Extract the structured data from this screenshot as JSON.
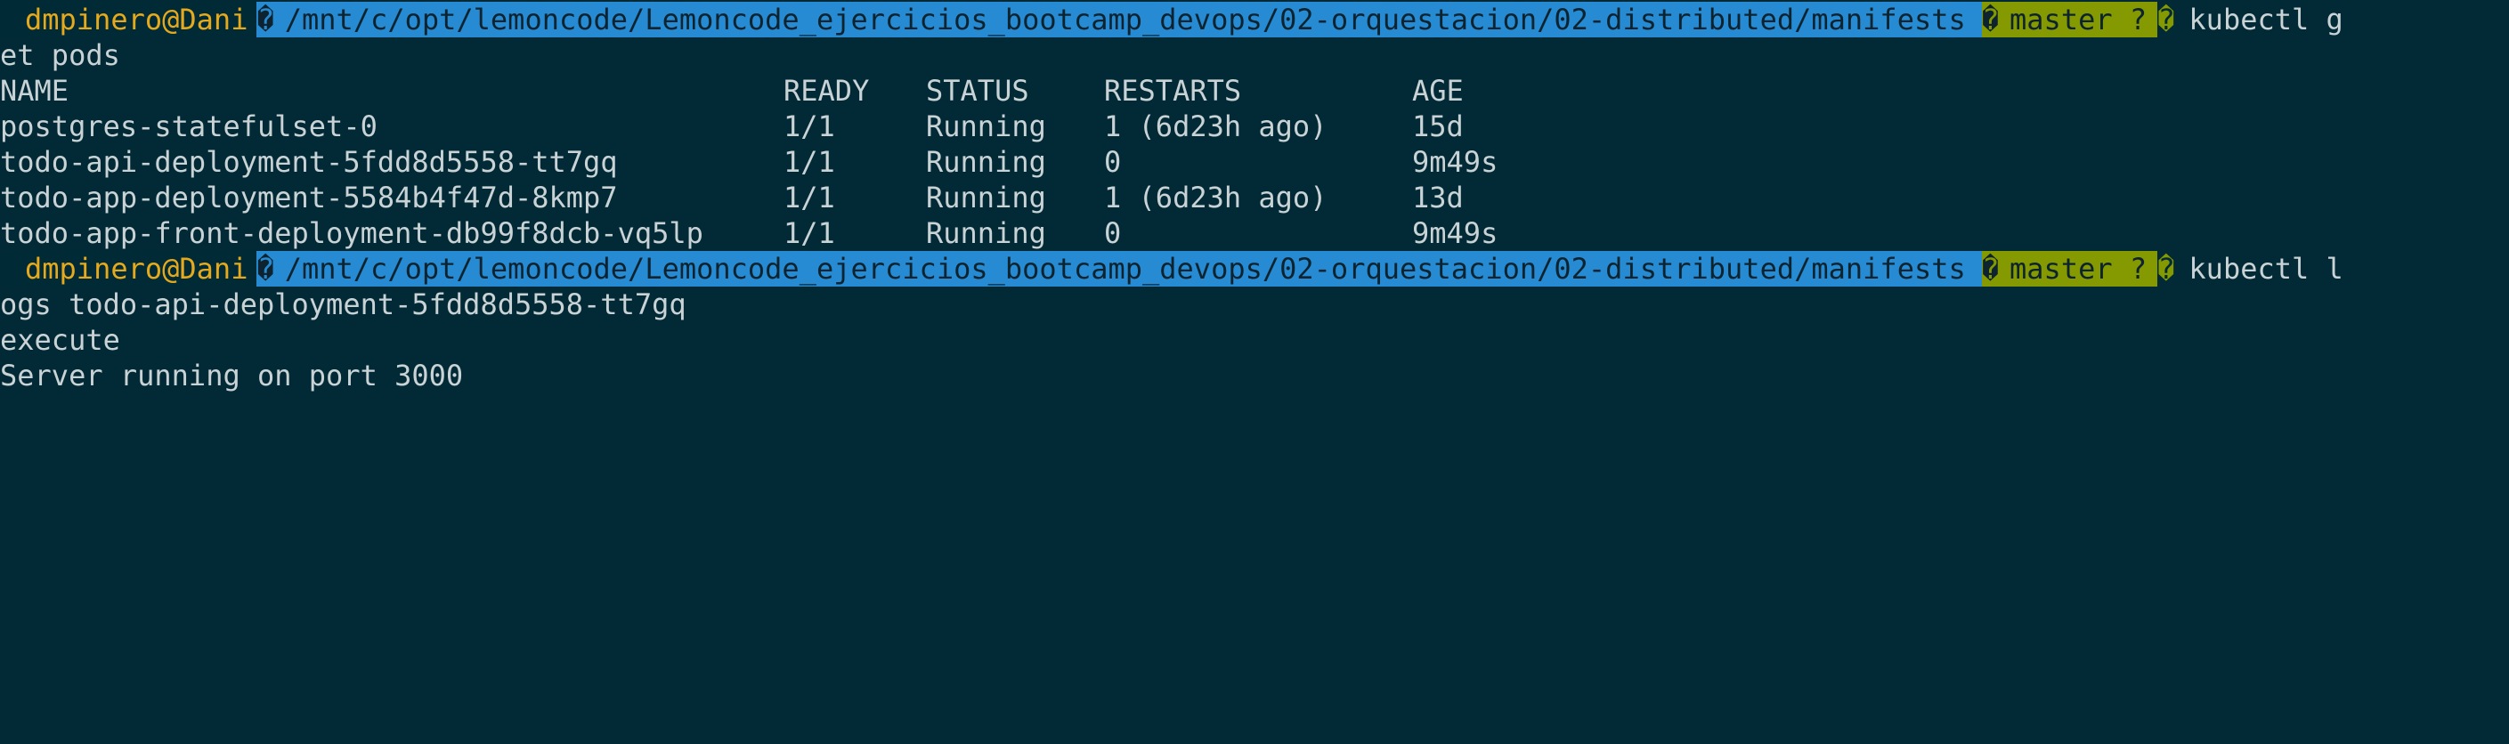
{
  "prompts": [
    {
      "user": "dmpinero@Dani",
      "path": "/mnt/c/opt/lemoncode/Lemoncode_ejercicios_bootcamp_devops/02-orquestacion/02-distributed/manifests",
      "branch": "master ?",
      "command_line1": "kubectl g",
      "command_line2": "et pods"
    },
    {
      "user": "dmpinero@Dani",
      "path": "/mnt/c/opt/lemoncode/Lemoncode_ejercicios_bootcamp_devops/02-orquestacion/02-distributed/manifests",
      "branch": "master ?",
      "command_line1": "kubectl l",
      "command_line2": "ogs todo-api-deployment-5fdd8d5558-tt7gq"
    }
  ],
  "glyphs": {
    "path_separator": "�",
    "git_separator": "�",
    "end_separator": "�"
  },
  "pods_table": {
    "headers": [
      "NAME",
      "READY",
      "STATUS",
      "RESTARTS",
      "AGE"
    ],
    "rows": [
      [
        "postgres-statefulset-0",
        "1/1",
        "Running",
        "1 (6d23h ago)",
        "15d"
      ],
      [
        "todo-api-deployment-5fdd8d5558-tt7gq",
        "1/1",
        "Running",
        "0",
        "9m49s"
      ],
      [
        "todo-app-deployment-5584b4f47d-8kmp7",
        "1/1",
        "Running",
        "1 (6d23h ago)",
        "13d"
      ],
      [
        "todo-app-front-deployment-db99f8dcb-vq5lp",
        "1/1",
        "Running",
        "0",
        "9m49s"
      ]
    ]
  },
  "logs_output": [
    "execute",
    "Server running on port 3000"
  ],
  "colors": {
    "background": "#012a36",
    "user": "#e5a91d",
    "path_segment": "#268bd2",
    "git_segment": "#859900",
    "text": "#c9d3d6"
  }
}
